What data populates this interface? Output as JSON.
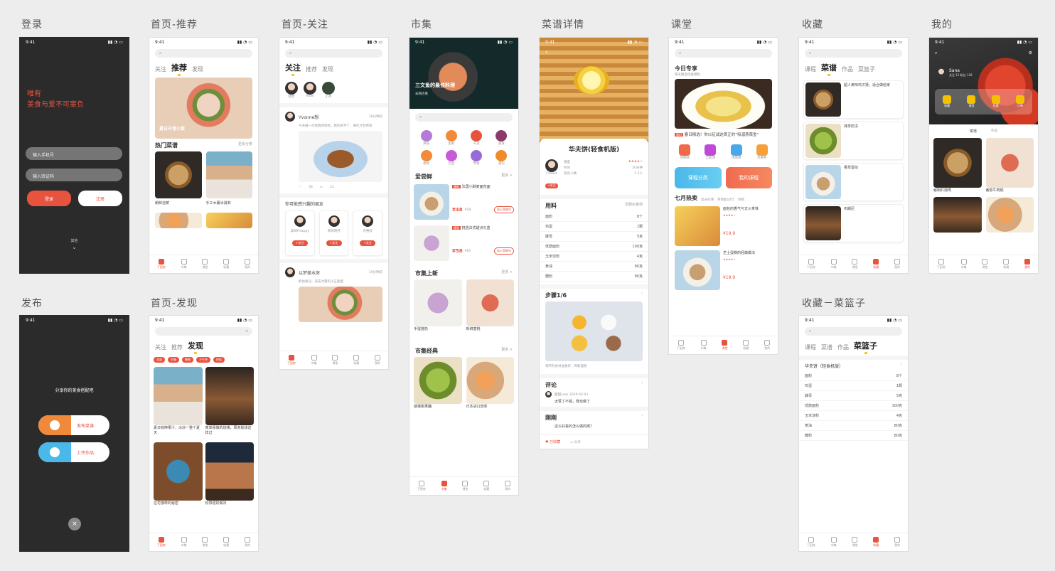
{
  "status_time": "9:41",
  "labels": {
    "login": "登录",
    "home_rec": "首页-推荐",
    "home_follow": "首页-关注",
    "market": "市集",
    "recipe_detail": "菜谱详情",
    "class": "课堂",
    "collect": "收藏",
    "mine": "我的",
    "publish": "发布",
    "home_discover": "首页-发现",
    "collect_basket": "收藏－菜篮子"
  },
  "login": {
    "slogan1": "唯有",
    "slogan2": "美食与爱不可辜负",
    "phone_placeholder": "输入手机号",
    "code_placeholder": "输入验证码",
    "login_btn": "登录",
    "register_btn": "注册",
    "bottom": "其他"
  },
  "home_tabs": [
    "关注",
    "推荐",
    "发现"
  ],
  "search_placeholder": "Q",
  "tabbar": [
    "下厨房",
    "市集",
    "课堂",
    "收藏",
    "我的"
  ],
  "home_rec": {
    "hot": "热门菜谱",
    "more": "更多分类",
    "cards": [
      "朝鲜泡菜",
      "手工木薯冰淇淋"
    ],
    "banner_text": "夏日开胃小菜"
  },
  "home_follow": {
    "users": [
      "晓梦",
      "Abdo",
      "小月"
    ],
    "post_user": "Yvonne想",
    "post_time": "10分钟前",
    "post_text": "今天做一次经典烤串啦，我的名字了，来吃才有烤串",
    "likes": "36",
    "comments": "12",
    "interest": "你可能感兴趣的朋友",
    "friends": [
      "美味FHappy",
      "清风明月",
      "许惠姣"
    ],
    "follow": "+关注",
    "post2_user": "以梦美水房",
    "post2_time": "10分钟前",
    "post2_text": "抓住秘诀，美味力量的小正能量"
  },
  "market": {
    "hero_title": "三文鱼的最佳料理",
    "sub": "去网店看",
    "cats": [
      "烘焙",
      "生鲜",
      "干货",
      "蔬食",
      "便食",
      "饮品",
      "零食",
      "重包"
    ],
    "s1": "爱尝鲜",
    "more": "更多 >",
    "items": [
      {
        "tag": "爆款",
        "name": "法国小酥麦面包面",
        "price": "¥48",
        "old": "¥58",
        "btn": "加入购物车"
      },
      {
        "tag": "爆款",
        "name": "挑选法式甜点礼盒",
        "price": "¥58",
        "old": "¥65",
        "btn": "加入购物车"
      }
    ],
    "s2": "市集上新",
    "new_items": [
      "手提搓奶",
      "新鲜蜜桃"
    ],
    "s3": "市集经典",
    "classic": [
      "猕猴桃果脯",
      "日本进口焙茶"
    ]
  },
  "recipe": {
    "name": "华夫饼(轻食机版)",
    "author": "Fcbbat",
    "rows": [
      [
        "难度",
        "★★★★☆"
      ],
      [
        "时间",
        "20分钟"
      ],
      [
        "适合人数",
        "1-2人"
      ]
    ],
    "ingredients": "用料",
    "buy": "去购买食材",
    "table": [
      [
        "面粉",
        "8个"
      ],
      [
        "鸡蛋",
        "1颗"
      ],
      [
        "酵母",
        "5克"
      ],
      [
        "低筋面粉",
        "100克"
      ],
      [
        "玉米淀粉",
        "4克"
      ],
      [
        "黄油",
        "80克"
      ],
      [
        "糖粉",
        "80克"
      ]
    ],
    "steps": "步骤1/6",
    "step_text": "将所有食材准备好，称取面粉",
    "comment": "评论",
    "c_user": "甜甜cook 2020-02-03",
    "c_text": "太赞了不错，我也做了",
    "more_comment": "刚刚",
    "c2_text": "这么好看的怎么做的呢？",
    "collect": "已收藏",
    "share": "分享"
  },
  "class": {
    "today": "今日专享",
    "sub": "每天精选优质课程",
    "title": "春日精选！你以征战这首正的“吸溜燕菜鱼”",
    "tag": "限时",
    "icons": [
      "热销榜",
      "全能课",
      "烘焙课",
      "优惠券"
    ],
    "btn1": "课程分类",
    "btn2": "我的课程",
    "hot": "七月热卖",
    "filters": [
      "高分好课",
      "月销超10万",
      "月销"
    ],
    "items": [
      {
        "name": "面包的香气与文火拿铁",
        "price": "¥19.9"
      },
      {
        "name": "芝士蛋糕的经典做法",
        "price": "¥19.9"
      }
    ]
  },
  "collect": {
    "tabs": [
      "课程",
      "菜谱",
      "作品",
      "菜篮子"
    ],
    "items": [
      "超人美味鸡爪煲，适合做给家",
      "抹茶奶冻",
      "香草蛋挞",
      "布朗尼",
      "法式甜点"
    ]
  },
  "mine": {
    "name": "Sana",
    "sub": "关注 12 粉丝 128",
    "tabs": [
      "菜谱",
      "作品"
    ],
    "icons": [
      "收藏",
      "课程",
      "优惠",
      "订单"
    ],
    "cards": [
      "秘制红烧肉",
      "番茄牛肉锅",
      "黑椒意面",
      "早餐拼盘"
    ]
  },
  "publish": {
    "title": "分享你的美食搭配吧",
    "btn1": "发布菜谱",
    "btn2": "上传作品"
  },
  "home_discover": {
    "tags": [
      "全部",
      "早餐",
      "晚餐",
      "下午茶",
      "烘焙"
    ],
    "cards": [
      "夏日鲜榨果汁，冰凉一整个夏天",
      "简单易做的烧烤，周末就该这样过",
      "拉花咖啡的秘密",
      "松饼塔的做法"
    ]
  },
  "basket": {
    "tabs": [
      "课程",
      "菜谱",
      "作品",
      "菜篮子"
    ],
    "recipe": "华夫饼（轻食机版）",
    "table": [
      [
        "面粉",
        "8个"
      ],
      [
        "鸡蛋",
        "1颗"
      ],
      [
        "酵母",
        "5克"
      ],
      [
        "低筋面粉",
        "100克"
      ],
      [
        "玉米淀粉",
        "4克"
      ],
      [
        "黄油",
        "80克"
      ],
      [
        "糖粉",
        "80克"
      ]
    ]
  }
}
